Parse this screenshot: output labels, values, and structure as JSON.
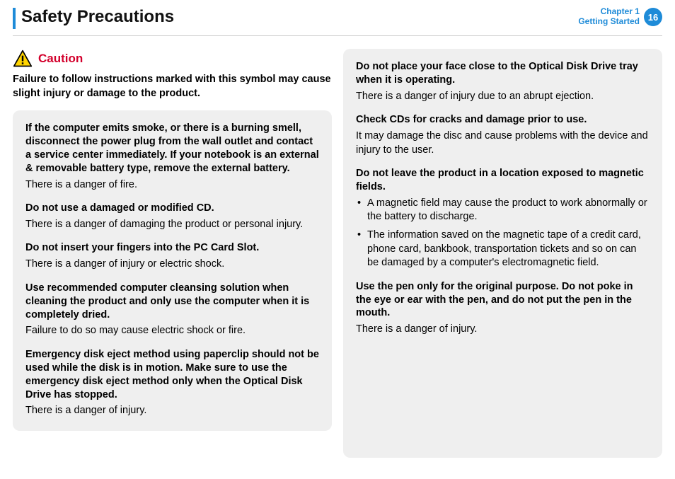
{
  "header": {
    "title": "Safety Precautions",
    "chapter_line1": "Chapter 1",
    "chapter_line2": "Getting Started",
    "page_number": "16"
  },
  "caution": {
    "label": "Caution",
    "lead": "Failure to follow instructions marked with this symbol may cause slight injury or damage to the product."
  },
  "left_panel": [
    {
      "h": "If the computer emits smoke, or there is a burning smell, disconnect the power plug from the wall outlet and contact a service center immediately. If your notebook is an external & removable battery type, remove the external battery.",
      "b": "There is a danger of fire."
    },
    {
      "h": "Do not use a damaged or modified CD.",
      "b": "There is a danger of damaging the product or personal injury."
    },
    {
      "h": "Do not insert your fingers into the PC Card Slot.",
      "b": "There is a danger of injury or electric shock."
    },
    {
      "h": "Use recommended computer cleansing solution when cleaning the product and only use the computer when it is completely dried.",
      "b": "Failure to do so may cause electric shock or fire."
    },
    {
      "h": "Emergency disk eject method using paperclip should not be used while the disk is in motion. Make sure to use the emergency disk eject method only when the Optical Disk Drive has stopped.",
      "b": "There is a danger of injury."
    }
  ],
  "right_panel": [
    {
      "h": "Do not place your face close to the Optical Disk Drive tray when it is operating.",
      "b": "There is a danger of injury due to an abrupt ejection."
    },
    {
      "h": "Check CDs for cracks and damage prior to use.",
      "b": "It may damage the disc and cause problems with the device and injury to the user."
    },
    {
      "h": "Do not leave the product in a location exposed to magnetic fields.",
      "bullets": [
        "A magnetic field may cause the product to work abnormally or the battery to discharge.",
        "The information saved on the magnetic tape of a credit card, phone card, bankbook, transportation tickets and so on can be damaged by a computer's electromagnetic field."
      ]
    },
    {
      "h": "Use the pen only for the original purpose. Do not poke in the eye or ear with the pen, and do not put the pen in the mouth.",
      "b": "There is a danger of injury."
    }
  ]
}
